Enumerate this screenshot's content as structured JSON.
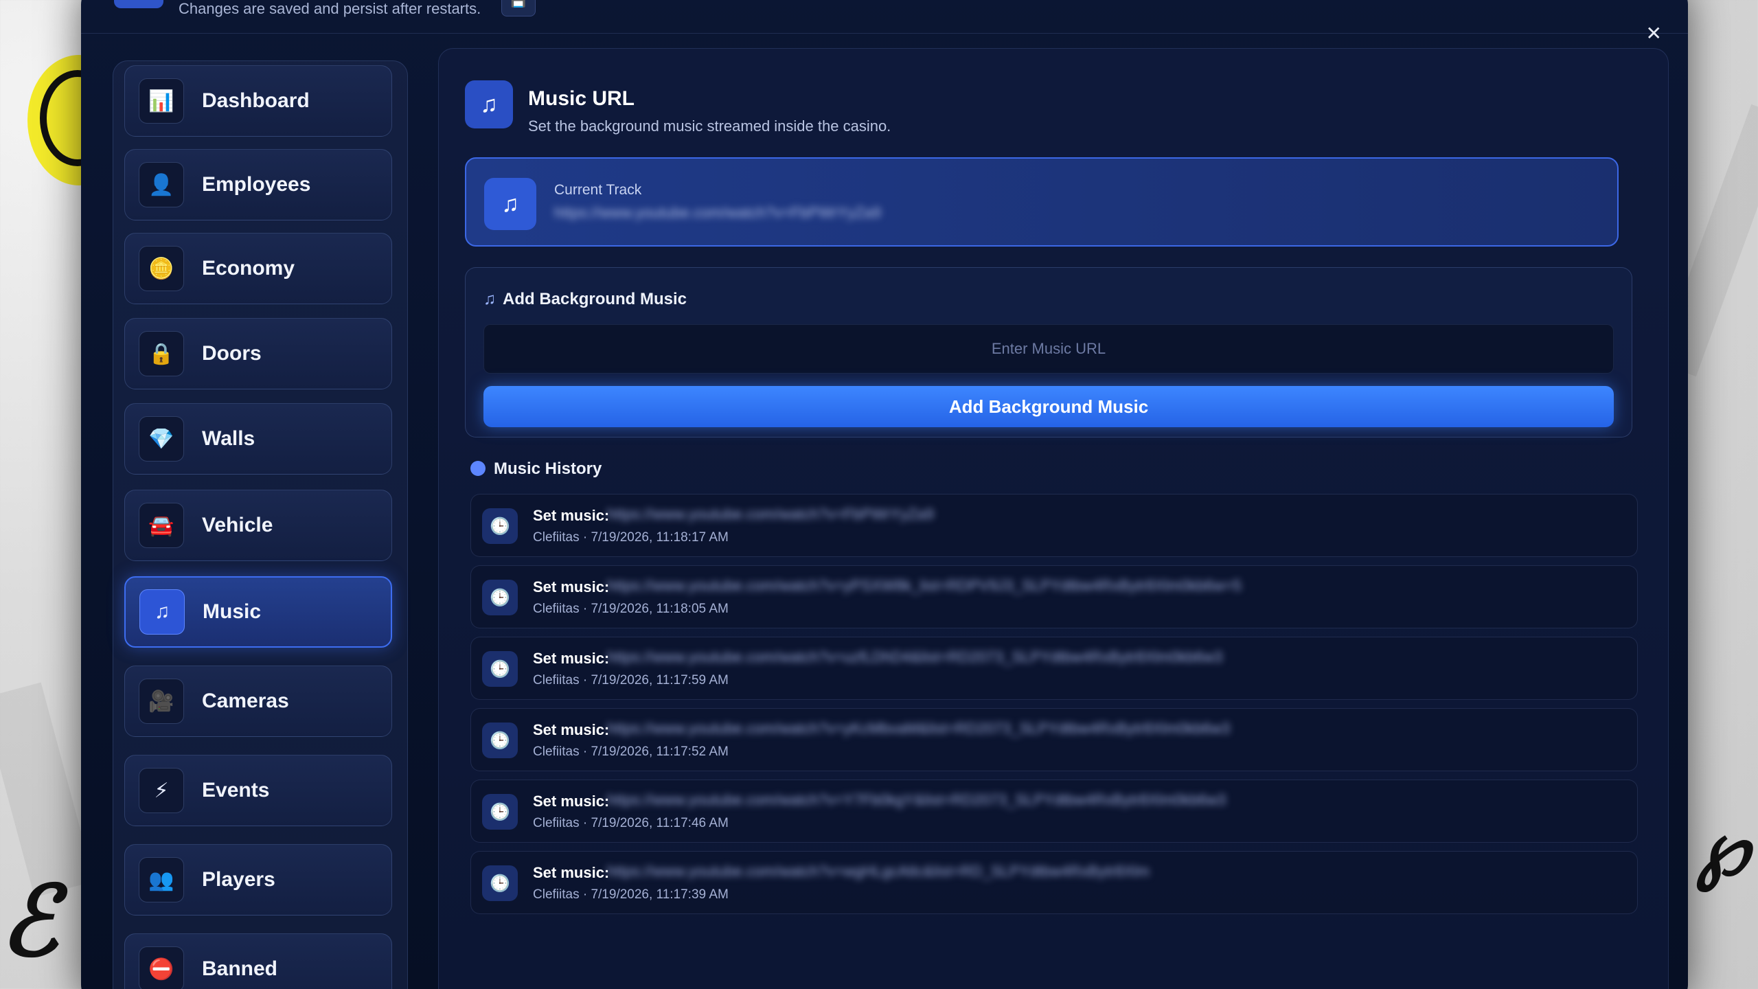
{
  "topbar": {
    "hint": "Changes are saved and persist after restarts."
  },
  "sidebar": {
    "items": [
      {
        "label": "Dashboard",
        "icon": "bar-chart-icon",
        "glyph": "📊"
      },
      {
        "label": "Employees",
        "icon": "user-gear-icon",
        "glyph": "👤"
      },
      {
        "label": "Economy",
        "icon": "coins-icon",
        "glyph": "🪙"
      },
      {
        "label": "Doors",
        "icon": "lock-icon",
        "glyph": "🔒"
      },
      {
        "label": "Walls",
        "icon": "gem-icon",
        "glyph": "💎"
      },
      {
        "label": "Vehicle",
        "icon": "car-icon",
        "glyph": "🚘"
      },
      {
        "label": "Music",
        "icon": "music-note-icon",
        "glyph": "♫",
        "active": true
      },
      {
        "label": "Cameras",
        "icon": "video-camera-icon",
        "glyph": "🎥"
      },
      {
        "label": "Events",
        "icon": "lightning-icon",
        "glyph": "⚡"
      },
      {
        "label": "Players",
        "icon": "users-icon",
        "glyph": "👥"
      },
      {
        "label": "Banned",
        "icon": "ban-icon",
        "glyph": "⛔"
      }
    ]
  },
  "main": {
    "title": "Music URL",
    "subtitle": "Set the background music streamed inside the casino.",
    "current_track": {
      "label": "Current Track",
      "value": "https://www.youtube.com/watch?v=FbPWrYyZa9"
    },
    "add": {
      "title": "Add Background Music",
      "placeholder": "Enter Music URL",
      "button_label": "Add Background Music"
    },
    "history": {
      "title": "Music History",
      "entries": [
        {
          "action": "Set music:",
          "url": "https://www.youtube.com/watch?v=FbPWrYyZa9",
          "meta": "Clefiitas · 7/19/2026, 11:18:17 AM"
        },
        {
          "action": "Set music:",
          "url": "https://www.youtube.com/watch?v=yPSXW8k_list=RDPV9J3_SLPYdtbw4RxBytr8Xlm0kb6w=5",
          "meta": "Clefiitas · 7/19/2026, 11:18:05 AM"
        },
        {
          "action": "Set music:",
          "url": "https://www.youtube.com/watch?v=uzfLDhD4&list=RD2073_SLPYdtbw4RxBytr8Xlm0kb6w3",
          "meta": "Clefiitas · 7/19/2026, 11:17:59 AM"
        },
        {
          "action": "Set music:",
          "url": "https://www.youtube.com/watch?v=yKcMbvaM&list=RD2073_SLPYdtbw4RxBytr8Xlm0kb6w3",
          "meta": "Clefiitas · 7/19/2026, 11:17:52 AM"
        },
        {
          "action": "Set music:",
          "url": "https://www.youtube.com/watch?v=Y7Fb0kgY&list=RD2073_SLPYdtbw4RxBytr8Xlm0kb6w3",
          "meta": "Clefiitas · 7/19/2026, 11:17:46 AM"
        },
        {
          "action": "Set music:",
          "url": "https://www.youtube.com/watch?v=wgHLgcAtlc&list=RD_SLPYdtbw4RxBytr8Xlm",
          "meta": "Clefiitas · 7/19/2026, 11:17:39 AM"
        }
      ]
    }
  },
  "colors": {
    "accent": "#3d6df0",
    "button": "#2563e6",
    "background": "#08122b"
  }
}
